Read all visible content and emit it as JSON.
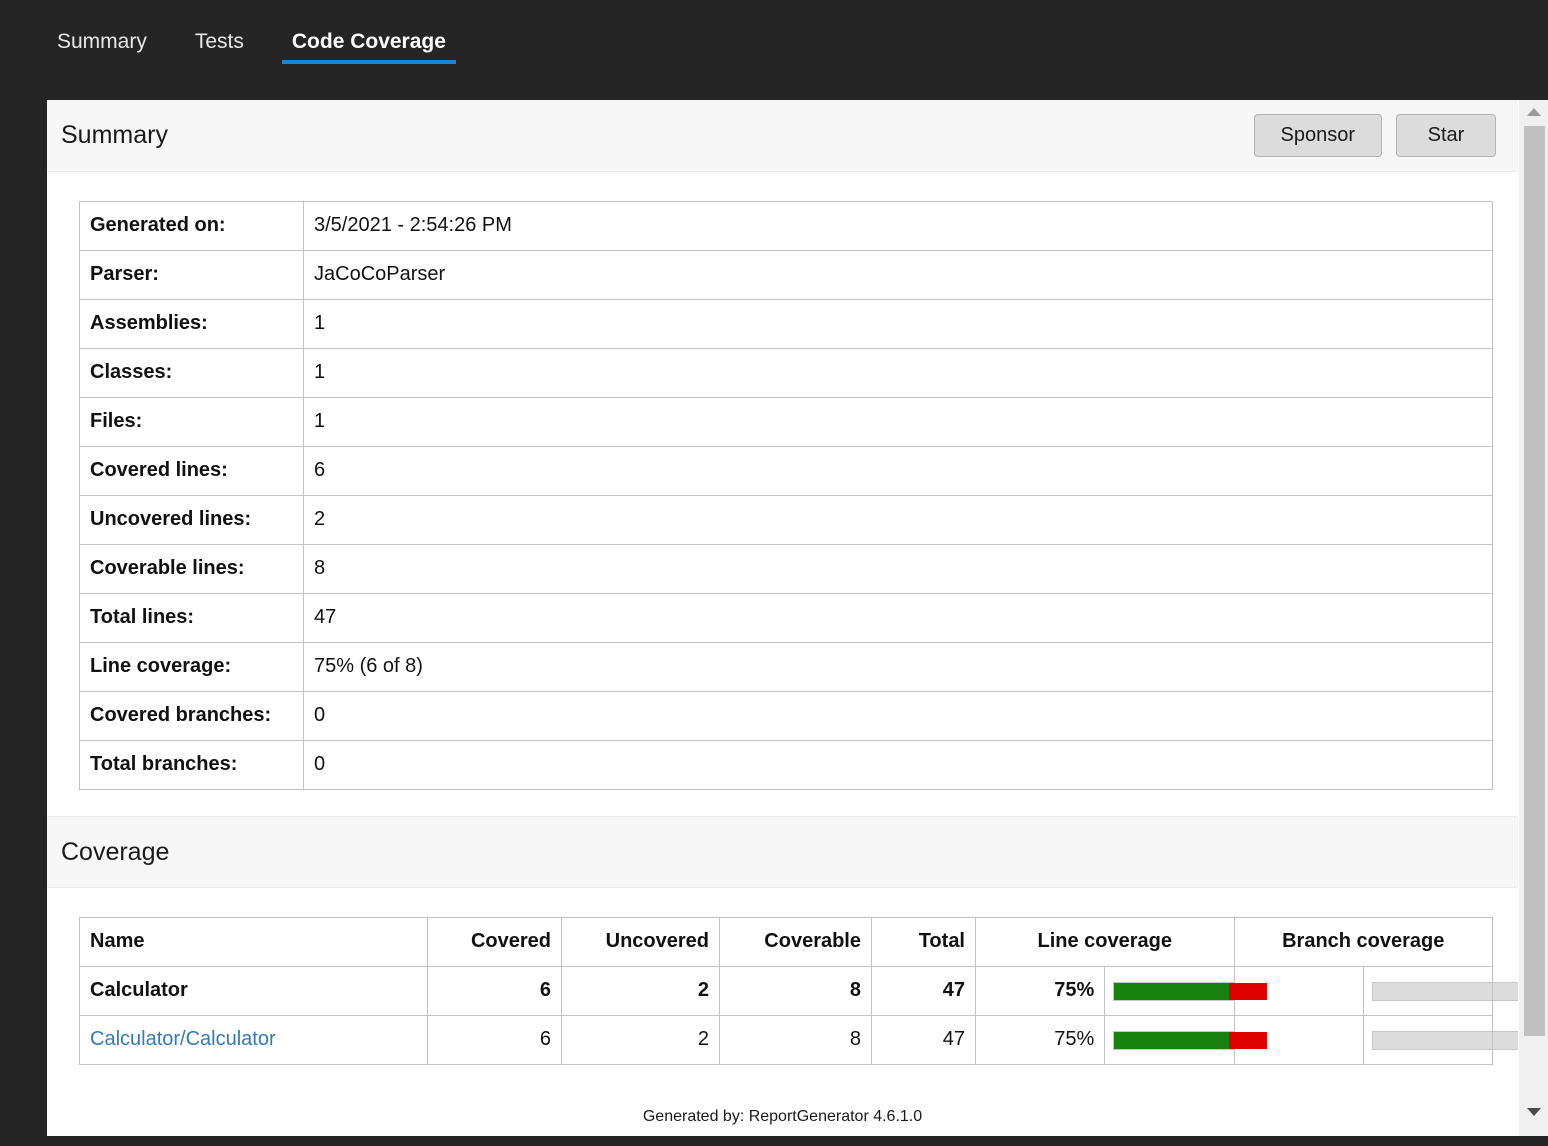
{
  "nav": {
    "tabs": [
      {
        "label": "Summary",
        "active": false
      },
      {
        "label": "Tests",
        "active": false
      },
      {
        "label": "Code Coverage",
        "active": true
      }
    ],
    "accent_color": "#1a86d0"
  },
  "summary_section": {
    "title": "Summary",
    "buttons": [
      {
        "label": "Sponsor"
      },
      {
        "label": "Star"
      }
    ],
    "rows": [
      {
        "key": "Generated on:",
        "value": "3/5/2021 - 2:54:26 PM"
      },
      {
        "key": "Parser:",
        "value": "JaCoCoParser"
      },
      {
        "key": "Assemblies:",
        "value": "1"
      },
      {
        "key": "Classes:",
        "value": "1"
      },
      {
        "key": "Files:",
        "value": "1"
      },
      {
        "key": "Covered lines:",
        "value": "6"
      },
      {
        "key": "Uncovered lines:",
        "value": "2"
      },
      {
        "key": "Coverable lines:",
        "value": "8"
      },
      {
        "key": "Total lines:",
        "value": "47"
      },
      {
        "key": "Line coverage:",
        "value": "75% (6 of 8)"
      },
      {
        "key": "Covered branches:",
        "value": "0"
      },
      {
        "key": "Total branches:",
        "value": "0"
      }
    ]
  },
  "coverage_section": {
    "title": "Coverage",
    "headers": {
      "name": "Name",
      "covered": "Covered",
      "uncovered": "Uncovered",
      "coverable": "Coverable",
      "total": "Total",
      "line_coverage": "Line coverage",
      "branch_coverage": "Branch coverage"
    },
    "rows": [
      {
        "name": "Calculator",
        "is_link": false,
        "covered": "6",
        "uncovered": "2",
        "coverable": "8",
        "total": "47",
        "line_pct_label": "75%",
        "line_pct": 75,
        "branch_pct_label": "",
        "branch_pct": 0
      },
      {
        "name": "Calculator/Calculator",
        "is_link": true,
        "covered": "6",
        "uncovered": "2",
        "coverable": "8",
        "total": "47",
        "line_pct_label": "75%",
        "line_pct": 75,
        "branch_pct_label": "",
        "branch_pct": 0
      }
    ],
    "bar_colors": {
      "covered": "#18820f",
      "uncovered": "#e00000",
      "empty": "#dcdcdc"
    }
  },
  "footer": {
    "text": "Generated by: ReportGenerator 4.6.1.0"
  },
  "scrollbar": {
    "up_arrow": "triangle-up-icon",
    "down_arrow": "triangle-down-icon"
  }
}
